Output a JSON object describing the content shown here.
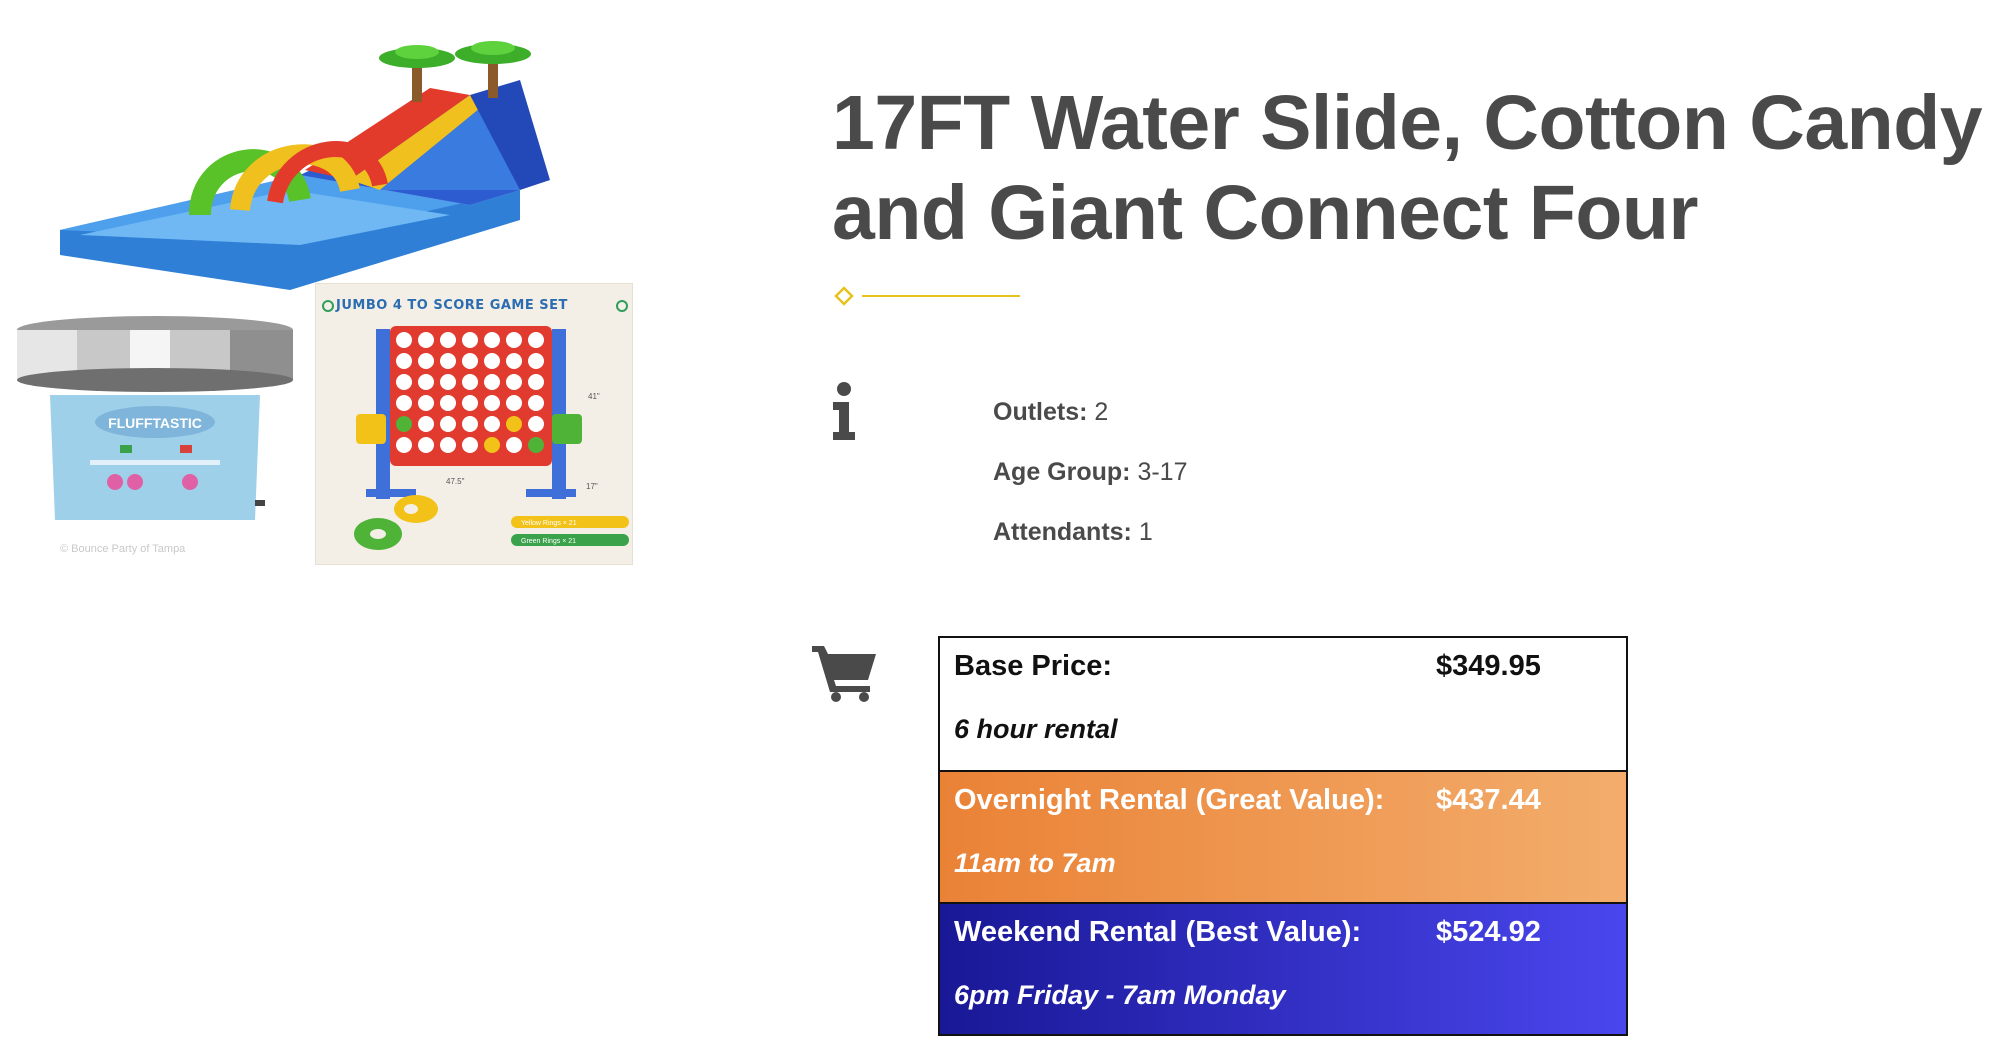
{
  "product": {
    "title_line1": "17FT Water Slide, Cotton Candy",
    "title_line2": "and Giant Connect Four"
  },
  "images": {
    "connect_four_header": "JUMBO 4 TO SCORE GAME SET",
    "connect_four_labels": {
      "width": "47.5\"",
      "height": "41\"",
      "depth": "17\"",
      "yellow": "Yellow Rings × 21",
      "green": "Green Rings × 21"
    },
    "cotton_candy_brand": "FLUFFTASTIC",
    "watermark": "© Bounce Party of Tampa"
  },
  "info": {
    "items": [
      {
        "label": "Outlets:",
        "value": "2"
      },
      {
        "label": "Age Group:",
        "value": "3-17"
      },
      {
        "label": "Attendants:",
        "value": "1"
      }
    ]
  },
  "pricing": {
    "tiers": [
      {
        "name": "Base Price:",
        "price": "$349.95",
        "note": "6 hour rental"
      },
      {
        "name": "Overnight Rental (Great Value):",
        "price": "$437.44",
        "note": "11am to 7am"
      },
      {
        "name": "Weekend Rental (Best Value):",
        "price": "$524.92",
        "note": "6pm Friday - 7am Monday"
      }
    ]
  },
  "colors": {
    "title": "#4a4a4a",
    "accent_divider": "#e8c21c",
    "overnight_start": "#ea8236",
    "overnight_end": "#f3ad6c",
    "weekend_start": "#191896",
    "weekend_end": "#4a46ee"
  },
  "icons": {
    "info": "info-icon",
    "cart": "cart-icon"
  }
}
